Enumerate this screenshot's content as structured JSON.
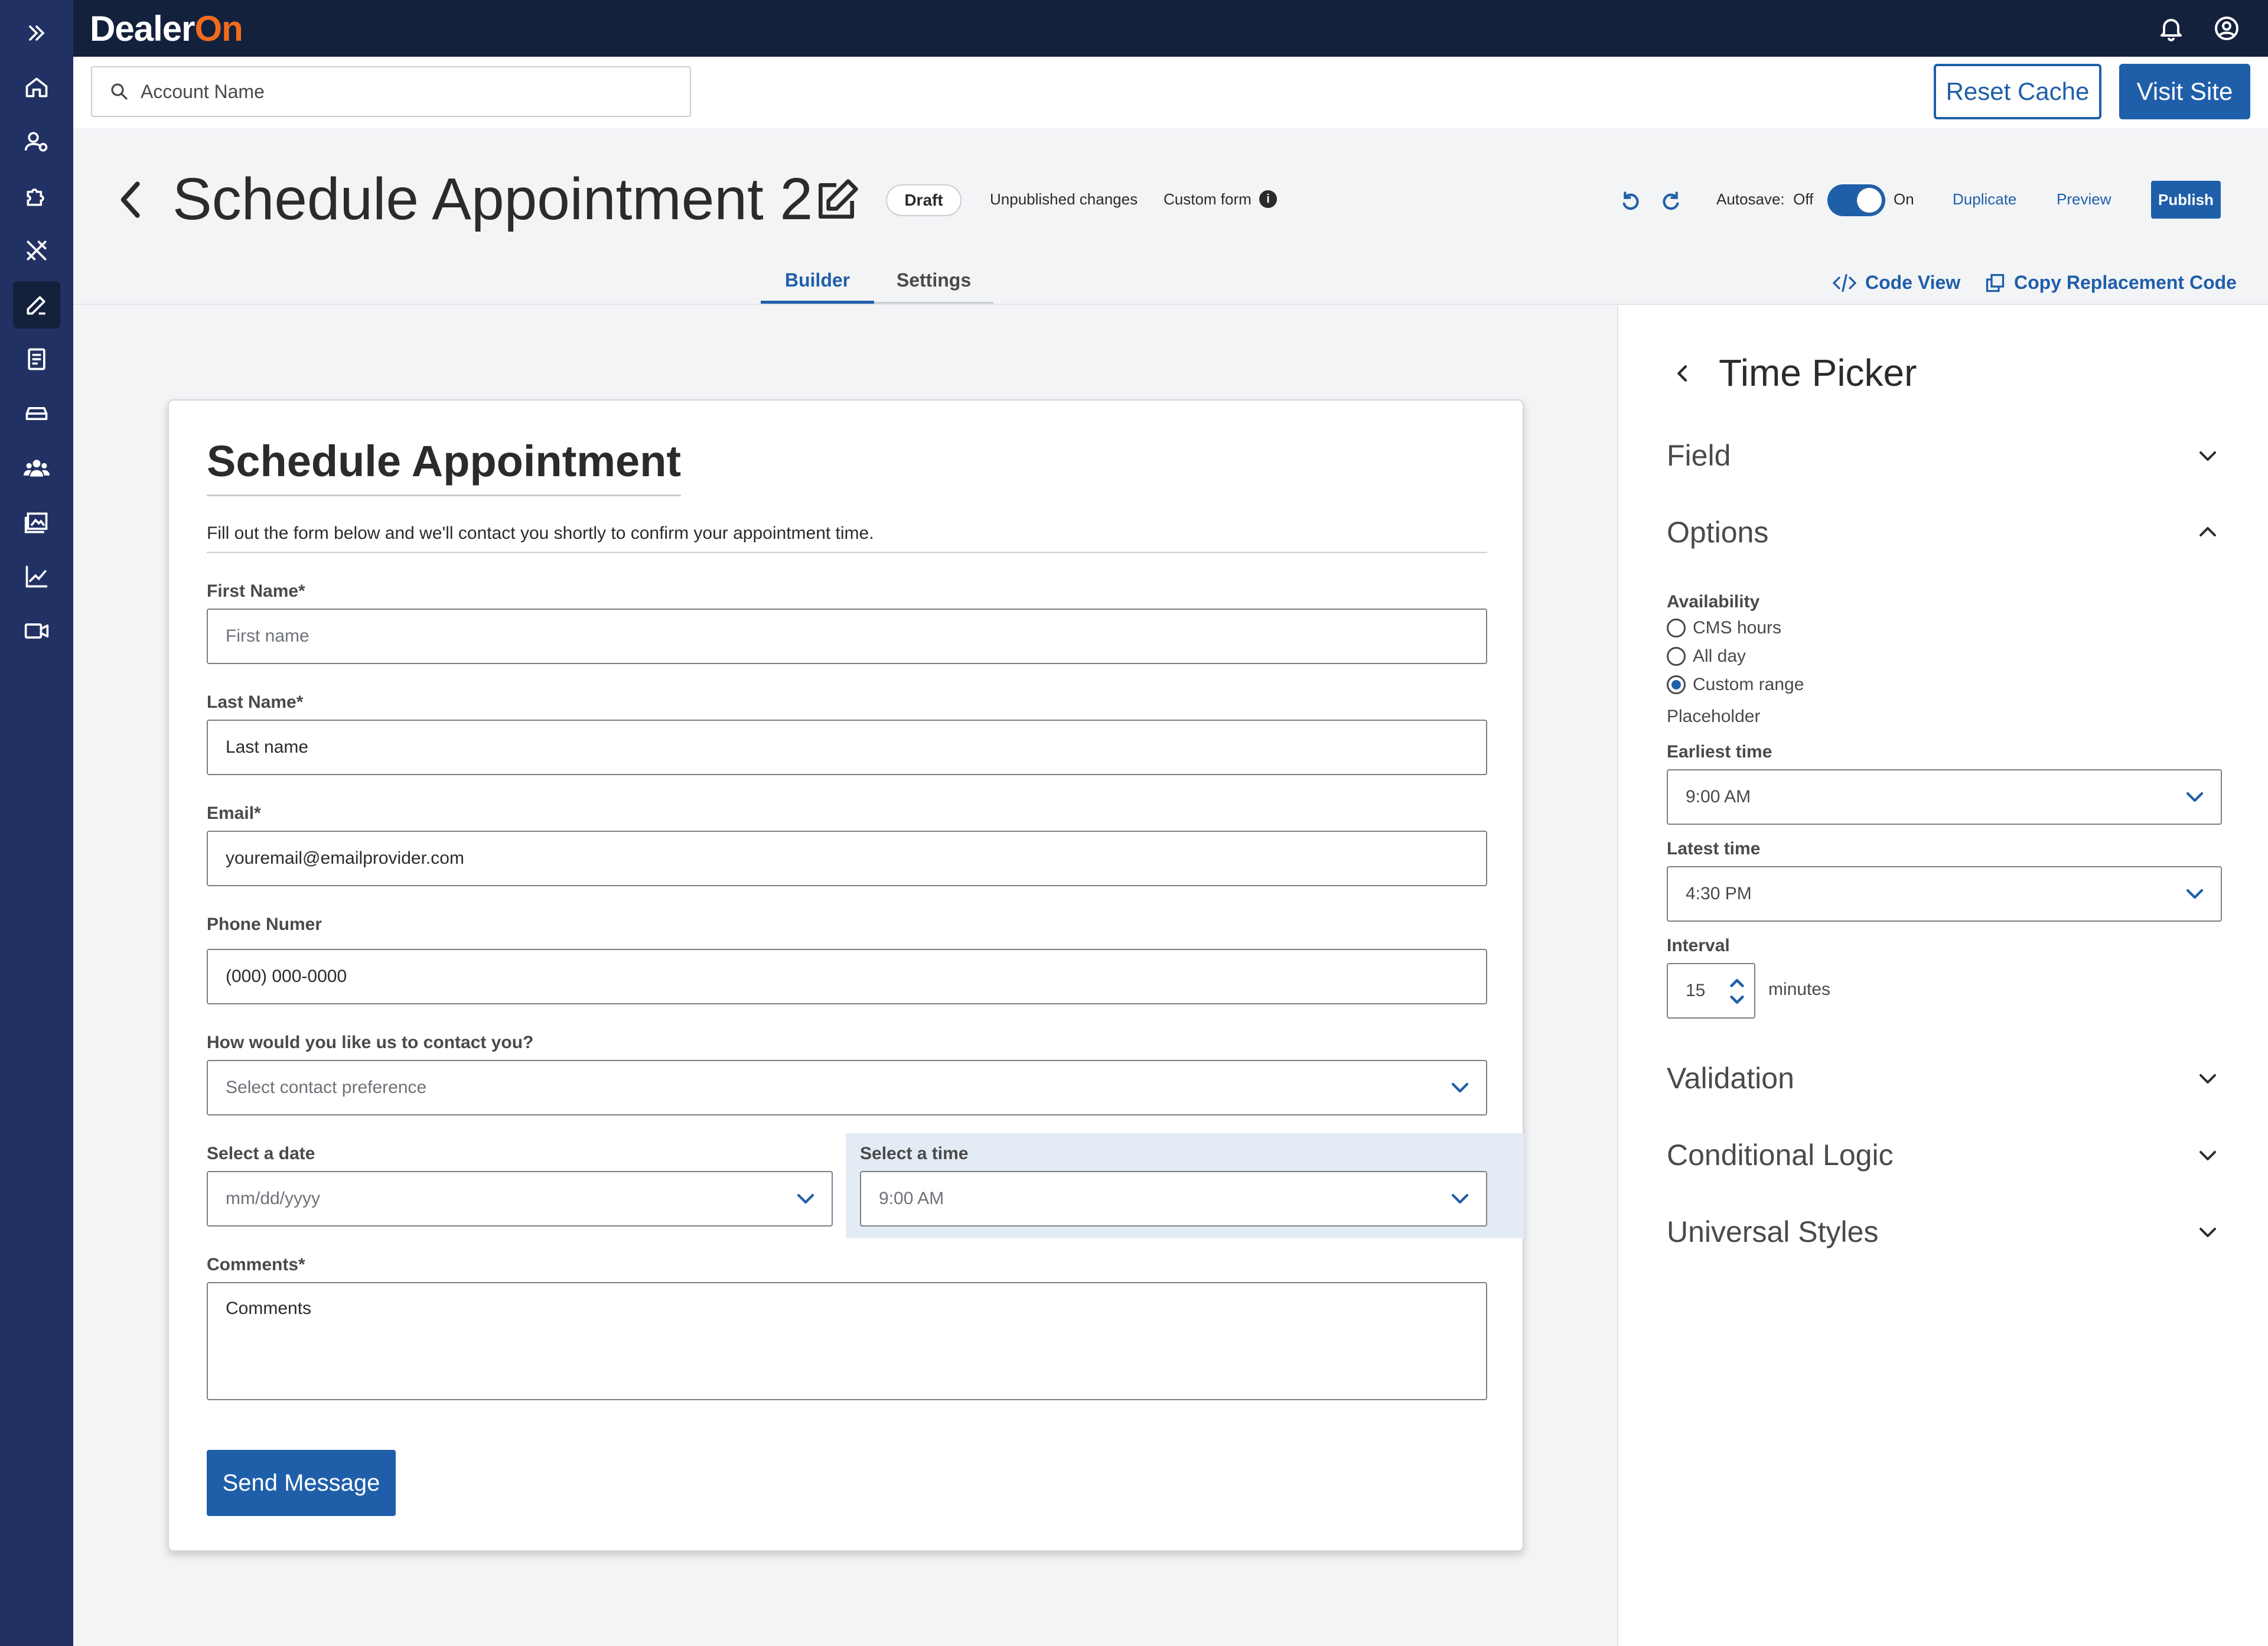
{
  "brand": {
    "logo_main": "Dealer",
    "logo_accent": "On",
    "accent_color": "#f26b1d",
    "primary_color": "#1f5fa9"
  },
  "topbar": {
    "icons": [
      "bell-icon",
      "user-circle-icon"
    ]
  },
  "nav": {
    "icons": [
      "expand-icon",
      "home-icon",
      "user-settings-icon",
      "puzzle-icon",
      "tools-icon",
      "edit-icon",
      "document-icon",
      "car-icon",
      "team-icon",
      "gallery-icon",
      "chart-icon",
      "video-icon"
    ],
    "active_index": 5
  },
  "account": {
    "search_placeholder": "Account Name",
    "reset_cache": "Reset Cache",
    "visit_site": "Visit Site"
  },
  "header": {
    "title": "Schedule Appointment 2",
    "status": "Draft",
    "unpublished": "Unpublished changes",
    "form_type": "Custom form",
    "info": "i",
    "autosave_label": "Autosave:",
    "autosave_off": "Off",
    "autosave_on": "On",
    "autosave_enabled": true,
    "duplicate": "Duplicate",
    "preview": "Preview",
    "publish": "Publish"
  },
  "tabs": [
    {
      "label": "Builder",
      "active": true
    },
    {
      "label": "Settings",
      "active": false
    }
  ],
  "code_links": {
    "code_view": "Code View",
    "copy_code": "Copy Replacement Code"
  },
  "form": {
    "title": "Schedule Appointment",
    "description": "Fill out the form below and we'll contact you shortly to confirm your appointment time.",
    "first_name": {
      "label": "First Name*",
      "placeholder": "First name"
    },
    "last_name": {
      "label": "Last Name*",
      "value": "Last name"
    },
    "email": {
      "label": "Email*",
      "value": "youremail@emailprovider.com"
    },
    "phone": {
      "label": "Phone Numer",
      "value": "(000) 000-0000"
    },
    "contact": {
      "label": "How would you like us to contact you?",
      "placeholder": "Select contact preference"
    },
    "date": {
      "label": "Select a date",
      "placeholder": "mm/dd/yyyy"
    },
    "time": {
      "label": "Select a time",
      "value": "9:00 AM"
    },
    "comments": {
      "label": "Comments*",
      "value": "Comments"
    },
    "submit": "Send Message"
  },
  "panel": {
    "title": "Time Picker",
    "field": "Field",
    "options": "Options",
    "availability_label": "Availability",
    "availability_options": [
      "CMS hours",
      "All day",
      "Custom range"
    ],
    "availability_selected": 2,
    "placeholder_label": "Placeholder",
    "earliest_label": "Earliest time",
    "earliest_value": "9:00 AM",
    "latest_label": "Latest time",
    "latest_value": "4:30 PM",
    "interval_label": "Interval",
    "interval_value": "15",
    "interval_unit": "minutes",
    "validation": "Validation",
    "conditional": "Conditional Logic",
    "universal": "Universal Styles"
  }
}
